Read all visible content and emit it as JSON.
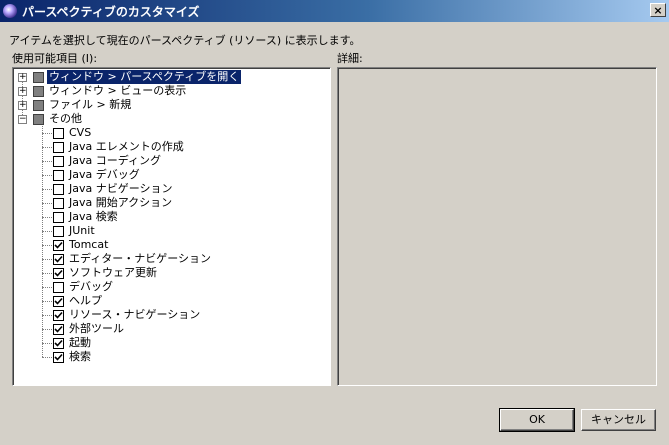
{
  "window": {
    "title": "パースペクティブのカスタマイズ",
    "close_glyph": "×"
  },
  "instruction": "アイテムを選択して現在のパースペクティブ (リソース) に表示します。",
  "available_label": "使用可能項目 (I):",
  "details_label": "詳細:",
  "tree": {
    "categories": [
      {
        "label": "ウィンドウ > パースペクティブを開く",
        "expanded": false,
        "selected": true
      },
      {
        "label": "ウィンドウ > ビューの表示",
        "expanded": false
      },
      {
        "label": "ファイル > 新規",
        "expanded": false
      },
      {
        "label": "その他",
        "expanded": true
      }
    ],
    "children": [
      {
        "label": "CVS",
        "checked": false
      },
      {
        "label": "Java エレメントの作成",
        "checked": false
      },
      {
        "label": "Java コーディング",
        "checked": false
      },
      {
        "label": "Java デバッグ",
        "checked": false
      },
      {
        "label": "Java ナビゲーション",
        "checked": false
      },
      {
        "label": "Java 開始アクション",
        "checked": false
      },
      {
        "label": "Java 検索",
        "checked": false
      },
      {
        "label": "JUnit",
        "checked": false
      },
      {
        "label": "Tomcat",
        "checked": true
      },
      {
        "label": "エディター・ナビゲーション",
        "checked": true
      },
      {
        "label": "ソフトウェア更新",
        "checked": true
      },
      {
        "label": "デバッグ",
        "checked": false
      },
      {
        "label": "ヘルプ",
        "checked": true
      },
      {
        "label": "リソース・ナビゲーション",
        "checked": true
      },
      {
        "label": "外部ツール",
        "checked": true
      },
      {
        "label": "起動",
        "checked": true
      },
      {
        "label": "検索",
        "checked": true
      }
    ]
  },
  "buttons": {
    "ok": "OK",
    "cancel": "キャンセル"
  },
  "expander_glyphs": {
    "collapsed": "+",
    "expanded": "−"
  }
}
